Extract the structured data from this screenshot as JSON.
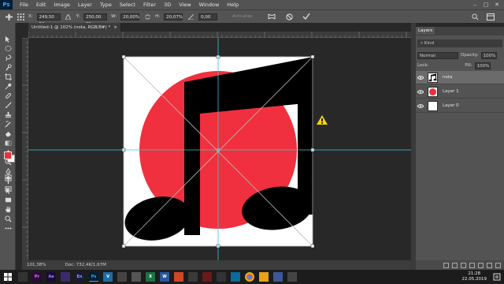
{
  "app": {
    "logo": "Ps",
    "win_controls": [
      "–",
      "▢",
      "✕"
    ]
  },
  "menu": [
    "File",
    "Edit",
    "Image",
    "Layer",
    "Type",
    "Select",
    "Filter",
    "3D",
    "View",
    "Window",
    "Help"
  ],
  "options_bar": {
    "x_label": "X:",
    "x_value": "249,50 px",
    "y_label": "Y:",
    "y_value": "250,00 px",
    "w_label": "W:",
    "w_value": "20,00%",
    "h_label": "H:",
    "h_value": "20,07%",
    "angle_value": "0,00",
    "interp_label": "Anti-alias"
  },
  "document": {
    "tab_title": "Untitled-1 @ 102% (nota, RGB/8#) *",
    "close": "×"
  },
  "status": {
    "zoom": "101,38%",
    "doc": "Doc: 732,4K/1,67M"
  },
  "colors": {
    "foreground": "#e8323d",
    "background": "#ffffff",
    "circle": "#f0303e",
    "guide": "#3ec6d6"
  },
  "layers_panel": {
    "tab_label": "Layers",
    "kind": "Kind",
    "blend_mode": "Normal",
    "opacity_label": "Opacity:",
    "opacity_value": "100%",
    "lock_label": "Lock:",
    "fill_label": "Fill:",
    "fill_value": "100%",
    "layers": [
      {
        "name": "nota",
        "selected": true,
        "thumb": "music-note"
      },
      {
        "name": "Layer 1",
        "selected": false,
        "thumb": "red-circle"
      },
      {
        "name": "Layer 0",
        "selected": false,
        "thumb": "white"
      }
    ]
  },
  "taskbar": {
    "apps": [
      "Pr",
      "Ae",
      "",
      "En",
      "Ps",
      "V",
      "",
      "",
      "X",
      "W",
      "",
      "",
      "",
      "",
      "",
      "",
      "",
      "",
      ""
    ],
    "time": "21:28",
    "date": "22.05.2019"
  }
}
